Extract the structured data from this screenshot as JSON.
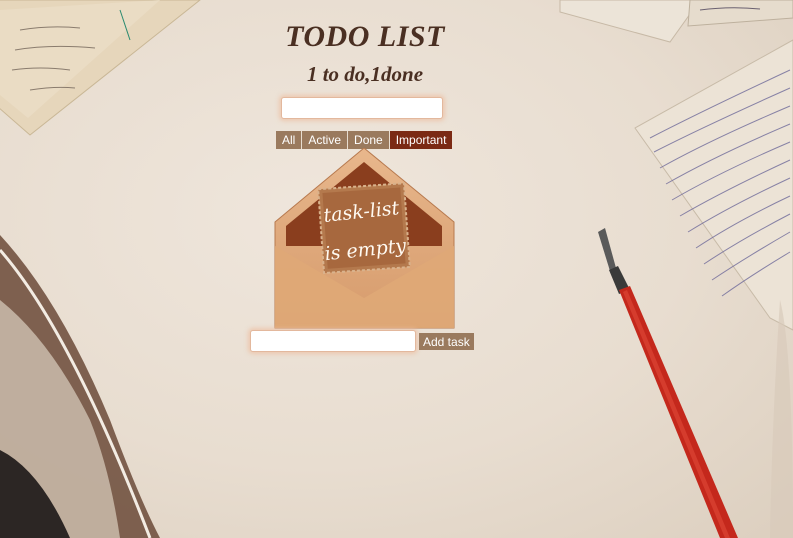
{
  "header": {
    "title": "TODO LIST",
    "summary": "1 to do,1done"
  },
  "search": {
    "value": "",
    "placeholder": ""
  },
  "filters": [
    {
      "label": "All",
      "active": false
    },
    {
      "label": "Active",
      "active": false
    },
    {
      "label": "Done",
      "active": false
    },
    {
      "label": "Important",
      "active": true
    }
  ],
  "empty_state": {
    "line1": "task-list",
    "line2": "is empty"
  },
  "add_task": {
    "value": "",
    "placeholder": "",
    "button_label": "Add task"
  },
  "colors": {
    "accent": "#7b2a14",
    "button": "#9a7a5e",
    "title": "#4a2f22"
  },
  "decor": {
    "icons": [
      "quill-feather-icon",
      "dip-pen-icon",
      "handwritten-letter-icon",
      "envelope-icon"
    ]
  }
}
